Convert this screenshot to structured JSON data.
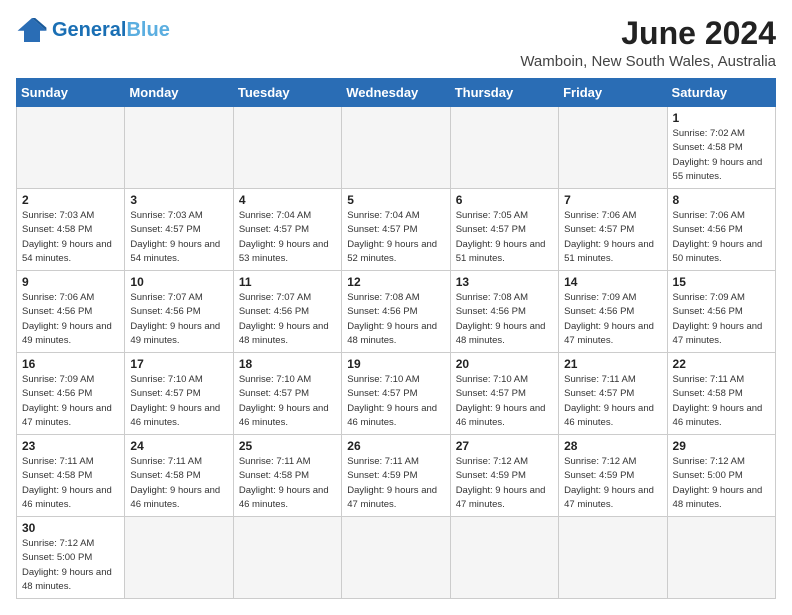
{
  "header": {
    "logo_general": "General",
    "logo_blue": "Blue",
    "month_year": "June 2024",
    "location": "Wamboin, New South Wales, Australia"
  },
  "days_of_week": [
    "Sunday",
    "Monday",
    "Tuesday",
    "Wednesday",
    "Thursday",
    "Friday",
    "Saturday"
  ],
  "weeks": [
    [
      {
        "day": "",
        "info": ""
      },
      {
        "day": "",
        "info": ""
      },
      {
        "day": "",
        "info": ""
      },
      {
        "day": "",
        "info": ""
      },
      {
        "day": "",
        "info": ""
      },
      {
        "day": "",
        "info": ""
      },
      {
        "day": "1",
        "info": "Sunrise: 7:02 AM\nSunset: 4:58 PM\nDaylight: 9 hours\nand 55 minutes."
      }
    ],
    [
      {
        "day": "2",
        "info": "Sunrise: 7:03 AM\nSunset: 4:58 PM\nDaylight: 9 hours\nand 54 minutes."
      },
      {
        "day": "3",
        "info": "Sunrise: 7:03 AM\nSunset: 4:57 PM\nDaylight: 9 hours\nand 54 minutes."
      },
      {
        "day": "4",
        "info": "Sunrise: 7:04 AM\nSunset: 4:57 PM\nDaylight: 9 hours\nand 53 minutes."
      },
      {
        "day": "5",
        "info": "Sunrise: 7:04 AM\nSunset: 4:57 PM\nDaylight: 9 hours\nand 52 minutes."
      },
      {
        "day": "6",
        "info": "Sunrise: 7:05 AM\nSunset: 4:57 PM\nDaylight: 9 hours\nand 51 minutes."
      },
      {
        "day": "7",
        "info": "Sunrise: 7:06 AM\nSunset: 4:57 PM\nDaylight: 9 hours\nand 51 minutes."
      },
      {
        "day": "8",
        "info": "Sunrise: 7:06 AM\nSunset: 4:56 PM\nDaylight: 9 hours\nand 50 minutes."
      }
    ],
    [
      {
        "day": "9",
        "info": "Sunrise: 7:06 AM\nSunset: 4:56 PM\nDaylight: 9 hours\nand 49 minutes."
      },
      {
        "day": "10",
        "info": "Sunrise: 7:07 AM\nSunset: 4:56 PM\nDaylight: 9 hours\nand 49 minutes."
      },
      {
        "day": "11",
        "info": "Sunrise: 7:07 AM\nSunset: 4:56 PM\nDaylight: 9 hours\nand 48 minutes."
      },
      {
        "day": "12",
        "info": "Sunrise: 7:08 AM\nSunset: 4:56 PM\nDaylight: 9 hours\nand 48 minutes."
      },
      {
        "day": "13",
        "info": "Sunrise: 7:08 AM\nSunset: 4:56 PM\nDaylight: 9 hours\nand 48 minutes."
      },
      {
        "day": "14",
        "info": "Sunrise: 7:09 AM\nSunset: 4:56 PM\nDaylight: 9 hours\nand 47 minutes."
      },
      {
        "day": "15",
        "info": "Sunrise: 7:09 AM\nSunset: 4:56 PM\nDaylight: 9 hours\nand 47 minutes."
      }
    ],
    [
      {
        "day": "16",
        "info": "Sunrise: 7:09 AM\nSunset: 4:56 PM\nDaylight: 9 hours\nand 47 minutes."
      },
      {
        "day": "17",
        "info": "Sunrise: 7:10 AM\nSunset: 4:57 PM\nDaylight: 9 hours\nand 46 minutes."
      },
      {
        "day": "18",
        "info": "Sunrise: 7:10 AM\nSunset: 4:57 PM\nDaylight: 9 hours\nand 46 minutes."
      },
      {
        "day": "19",
        "info": "Sunrise: 7:10 AM\nSunset: 4:57 PM\nDaylight: 9 hours\nand 46 minutes."
      },
      {
        "day": "20",
        "info": "Sunrise: 7:10 AM\nSunset: 4:57 PM\nDaylight: 9 hours\nand 46 minutes."
      },
      {
        "day": "21",
        "info": "Sunrise: 7:11 AM\nSunset: 4:57 PM\nDaylight: 9 hours\nand 46 minutes."
      },
      {
        "day": "22",
        "info": "Sunrise: 7:11 AM\nSunset: 4:58 PM\nDaylight: 9 hours\nand 46 minutes."
      }
    ],
    [
      {
        "day": "23",
        "info": "Sunrise: 7:11 AM\nSunset: 4:58 PM\nDaylight: 9 hours\nand 46 minutes."
      },
      {
        "day": "24",
        "info": "Sunrise: 7:11 AM\nSunset: 4:58 PM\nDaylight: 9 hours\nand 46 minutes."
      },
      {
        "day": "25",
        "info": "Sunrise: 7:11 AM\nSunset: 4:58 PM\nDaylight: 9 hours\nand 46 minutes."
      },
      {
        "day": "26",
        "info": "Sunrise: 7:11 AM\nSunset: 4:59 PM\nDaylight: 9 hours\nand 47 minutes."
      },
      {
        "day": "27",
        "info": "Sunrise: 7:12 AM\nSunset: 4:59 PM\nDaylight: 9 hours\nand 47 minutes."
      },
      {
        "day": "28",
        "info": "Sunrise: 7:12 AM\nSunset: 4:59 PM\nDaylight: 9 hours\nand 47 minutes."
      },
      {
        "day": "29",
        "info": "Sunrise: 7:12 AM\nSunset: 5:00 PM\nDaylight: 9 hours\nand 48 minutes."
      }
    ],
    [
      {
        "day": "30",
        "info": "Sunrise: 7:12 AM\nSunset: 5:00 PM\nDaylight: 9 hours\nand 48 minutes."
      },
      {
        "day": "",
        "info": ""
      },
      {
        "day": "",
        "info": ""
      },
      {
        "day": "",
        "info": ""
      },
      {
        "day": "",
        "info": ""
      },
      {
        "day": "",
        "info": ""
      },
      {
        "day": "",
        "info": ""
      }
    ]
  ]
}
